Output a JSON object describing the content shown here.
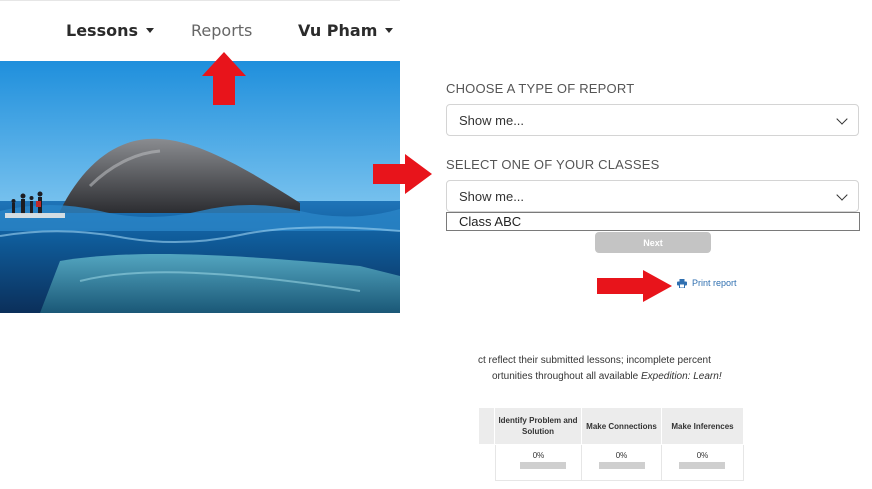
{
  "nav": {
    "lessons": "Lessons",
    "reports": "Reports",
    "user": "Vu Pham"
  },
  "form": {
    "report_type_label": "CHOOSE A TYPE OF REPORT",
    "report_type_value": "Show me...",
    "class_label": "SELECT ONE OF YOUR CLASSES",
    "class_value": "Show me...",
    "class_options": [
      "Class ABC"
    ],
    "next_label": "Next",
    "print_label": "Print report"
  },
  "note": {
    "line1": "ct reflect their submitted lessons; incomplete percent",
    "line2_prefix": "ortunities throughout all available ",
    "line2_italic": "Expedition: Learn!"
  },
  "table": {
    "headers": [
      "Identify Problem and Solution",
      "Make Connections",
      "Make Inferences"
    ],
    "values": [
      "0%",
      "0%",
      "0%"
    ],
    "progress": [
      0,
      0,
      0
    ]
  },
  "colors": {
    "arrow": "#e8141b",
    "link": "#2f6fb0",
    "button_disabled": "#c4c4c4"
  }
}
